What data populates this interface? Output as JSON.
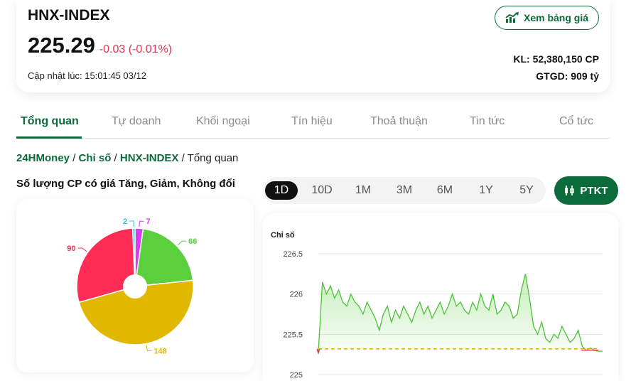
{
  "header": {
    "symbol": "HNX-INDEX",
    "price": "225.29",
    "change": "-0.03 (-0.01%)",
    "updated": "Cập nhật lúc: 15:01:45 03/12",
    "board_button": "Xem bảng giá",
    "volume": "KL: 52,380,150 CP",
    "value": "GTGD: 909 tỷ"
  },
  "icons": {
    "board": "chart-up-icon",
    "ptkt": "candlestick-icon"
  },
  "tabs": [
    "Tổng quan",
    "Tự doanh",
    "Khối ngoại",
    "Tín hiệu",
    "Thoả thuận",
    "Tin tức",
    "Cổ tức"
  ],
  "active_tab": "Tổng quan",
  "breadcrumb": {
    "items": [
      "24HMoney",
      "Chỉ số",
      "HNX-INDEX"
    ],
    "current": "Tổng quan",
    "separator": " / "
  },
  "breadth": {
    "title": "Số lượng CP có giá Tăng, Giảm, Không đổi"
  },
  "periods": [
    "1D",
    "10D",
    "1M",
    "3M",
    "6M",
    "1Y",
    "5Y"
  ],
  "active_period": "1D",
  "ptkt_button": "PTKT",
  "colors": {
    "brand": "#0b6b3a",
    "down": "#e0344f",
    "up": "#5ccf3f",
    "unchanged": "#e0b800",
    "ceiling": "#d63df0",
    "floor": "#29c7d6",
    "reference": "#e0a800"
  },
  "chart_data": [
    {
      "type": "pie",
      "slices": [
        {
          "value": 7,
          "label": "7",
          "color": "#d63df0"
        },
        {
          "value": 66,
          "label": "66",
          "color": "#5ccf3f"
        },
        {
          "value": 148,
          "label": "148",
          "color": "#e0b800"
        },
        {
          "value": 90,
          "label": "90",
          "color": "#ff2d55"
        },
        {
          "value": 2,
          "label": "2",
          "color": "#29c7d6"
        }
      ]
    },
    {
      "type": "area",
      "ylabel": "Chỉ số",
      "ylim": [
        225,
        226.5
      ],
      "yticks": [
        226.5,
        226,
        225.5,
        225
      ],
      "reference": 225.32,
      "values": [
        225.28,
        226.15,
        226.0,
        226.1,
        225.95,
        226.05,
        225.9,
        225.85,
        226.0,
        225.9,
        225.85,
        225.75,
        225.9,
        225.8,
        225.7,
        225.55,
        225.75,
        225.85,
        225.65,
        225.8,
        225.7,
        225.85,
        225.75,
        225.65,
        225.8,
        225.9,
        225.75,
        225.85,
        225.7,
        225.8,
        225.9,
        225.75,
        225.85,
        226.0,
        225.85,
        225.9,
        225.8,
        225.75,
        225.9,
        225.8,
        226.0,
        225.85,
        225.8,
        226.0,
        225.75,
        225.8,
        225.9,
        225.85,
        225.7,
        225.75,
        226.05,
        226.25,
        225.95,
        225.6,
        225.5,
        225.65,
        225.45,
        225.4,
        225.5,
        225.45,
        225.6,
        225.5,
        225.4,
        225.45,
        225.55,
        225.35,
        225.3,
        225.33,
        225.3,
        225.29,
        225.29
      ]
    }
  ]
}
